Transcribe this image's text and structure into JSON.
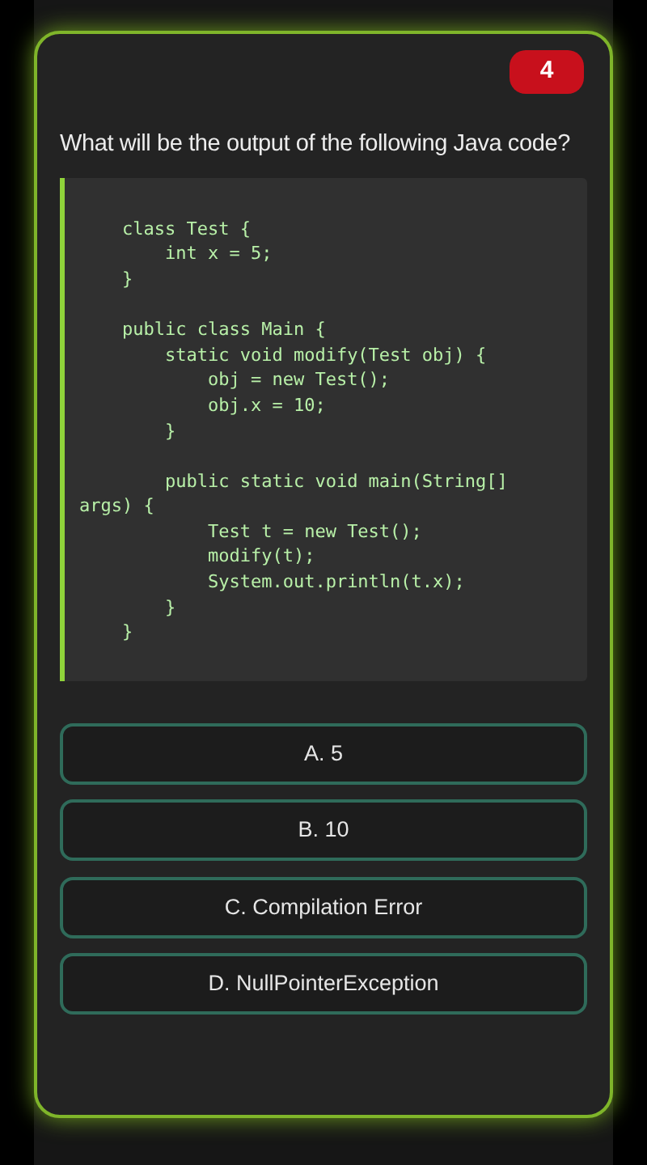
{
  "question_number": "4",
  "question": "What will be the output of the following Java code?",
  "code": "    class Test {\n        int x = 5;\n    }\n\n    public class Main {\n        static void modify(Test obj) {\n            obj = new Test();\n            obj.x = 10;\n        }\n\n        public static void main(String[]\nargs) {\n            Test t = new Test();\n            modify(t);\n            System.out.println(t.x);\n        }\n    }",
  "options": [
    {
      "label": "A. 5",
      "selected": false
    },
    {
      "label": "B. 10",
      "selected": false
    },
    {
      "label": "C. Compilation Error",
      "selected": false
    },
    {
      "label": "D. NullPointerException",
      "selected": false
    }
  ]
}
